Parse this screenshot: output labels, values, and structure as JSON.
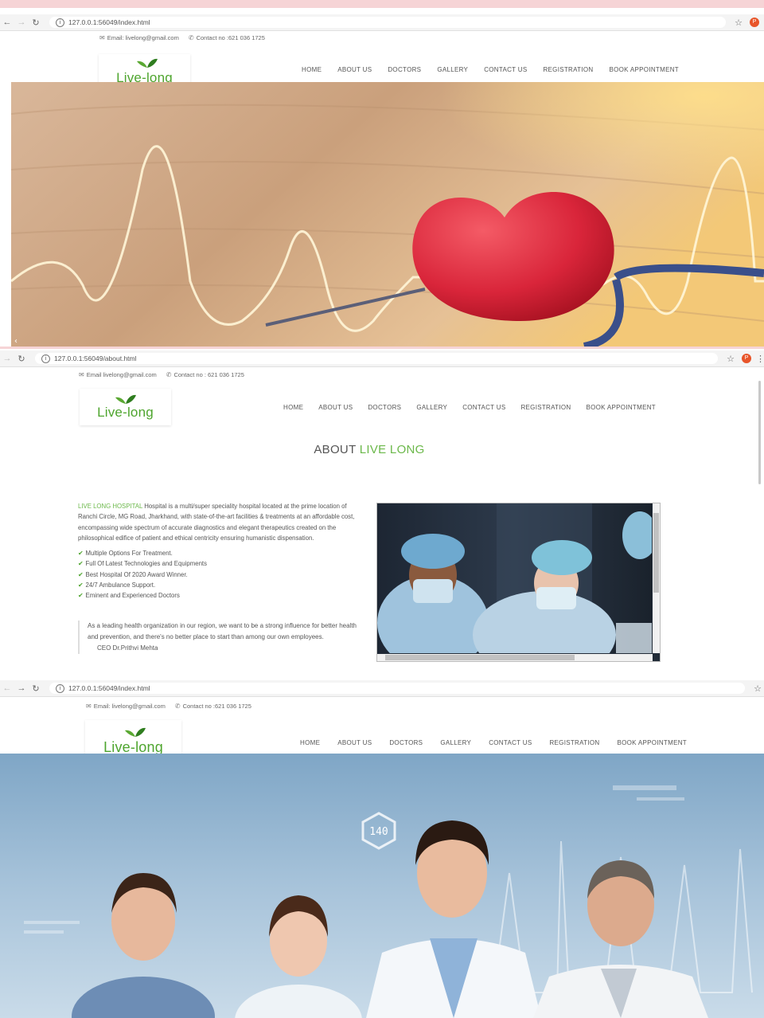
{
  "screens": [
    {
      "url": "127.0.0.1:56049/index.html",
      "email_label": "Email: livelong@gmail.com",
      "contact_label": "Contact no :621 036 1725"
    },
    {
      "url": "127.0.0.1:56049/about.html",
      "email_label": "Email livelong@gmail.com",
      "contact_label": "Contact no : 621 036 1725"
    },
    {
      "url": "127.0.0.1:56049/index.html",
      "email_label": "Email: livelong@gmail.com",
      "contact_label": "Contact no :621 036 1725"
    }
  ],
  "brand": {
    "logo_text": "Live-long"
  },
  "nav": [
    "HOME",
    "ABOUT US",
    "DOCTORS",
    "GALLERY",
    "CONTACT US",
    "REGISTRATION",
    "BOOK APPOINTMENT"
  ],
  "about": {
    "title_prefix": "ABOUT ",
    "title_highlight": "LIVE LONG",
    "hospital_name": "LIVE LONG HOSPITAL",
    "intro": " Hospital is a multi/super speciality hospital located at the prime location of Ranchi Circle, MG Road, Jharkhand, with state-of-the-art facilities & treatments at an affordable cost, encompassing wide spectrum of accurate diagnostics and elegant therapeutics created on the philosophical edifice of patient and ethical centricity ensuring humanistic dispensation.",
    "features": [
      "Multiple Options For Treatment.",
      "Full Of Latest Technologies and Equipments",
      "Best Hospital Of 2020 Award Winner.",
      "24/7 Ambulance Support.",
      "Eminent and Experienced Doctors"
    ],
    "quote": "As a leading health organization in our region, we want to be a strong influence for better health and prevention, and there's no better place to start than among our own employees.",
    "quote_author": "CEO Dr.Prithvi Mehta"
  },
  "hero3": {
    "badge": "140"
  },
  "colors": {
    "brand_green": "#4ea52e",
    "accent_orange": "#e8552a"
  },
  "icons": {
    "back": "back-arrow-icon",
    "forward": "forward-arrow-icon",
    "reload": "reload-icon",
    "star": "star-icon",
    "email": "mail-icon",
    "phone": "phone-icon",
    "check": "check-icon"
  }
}
